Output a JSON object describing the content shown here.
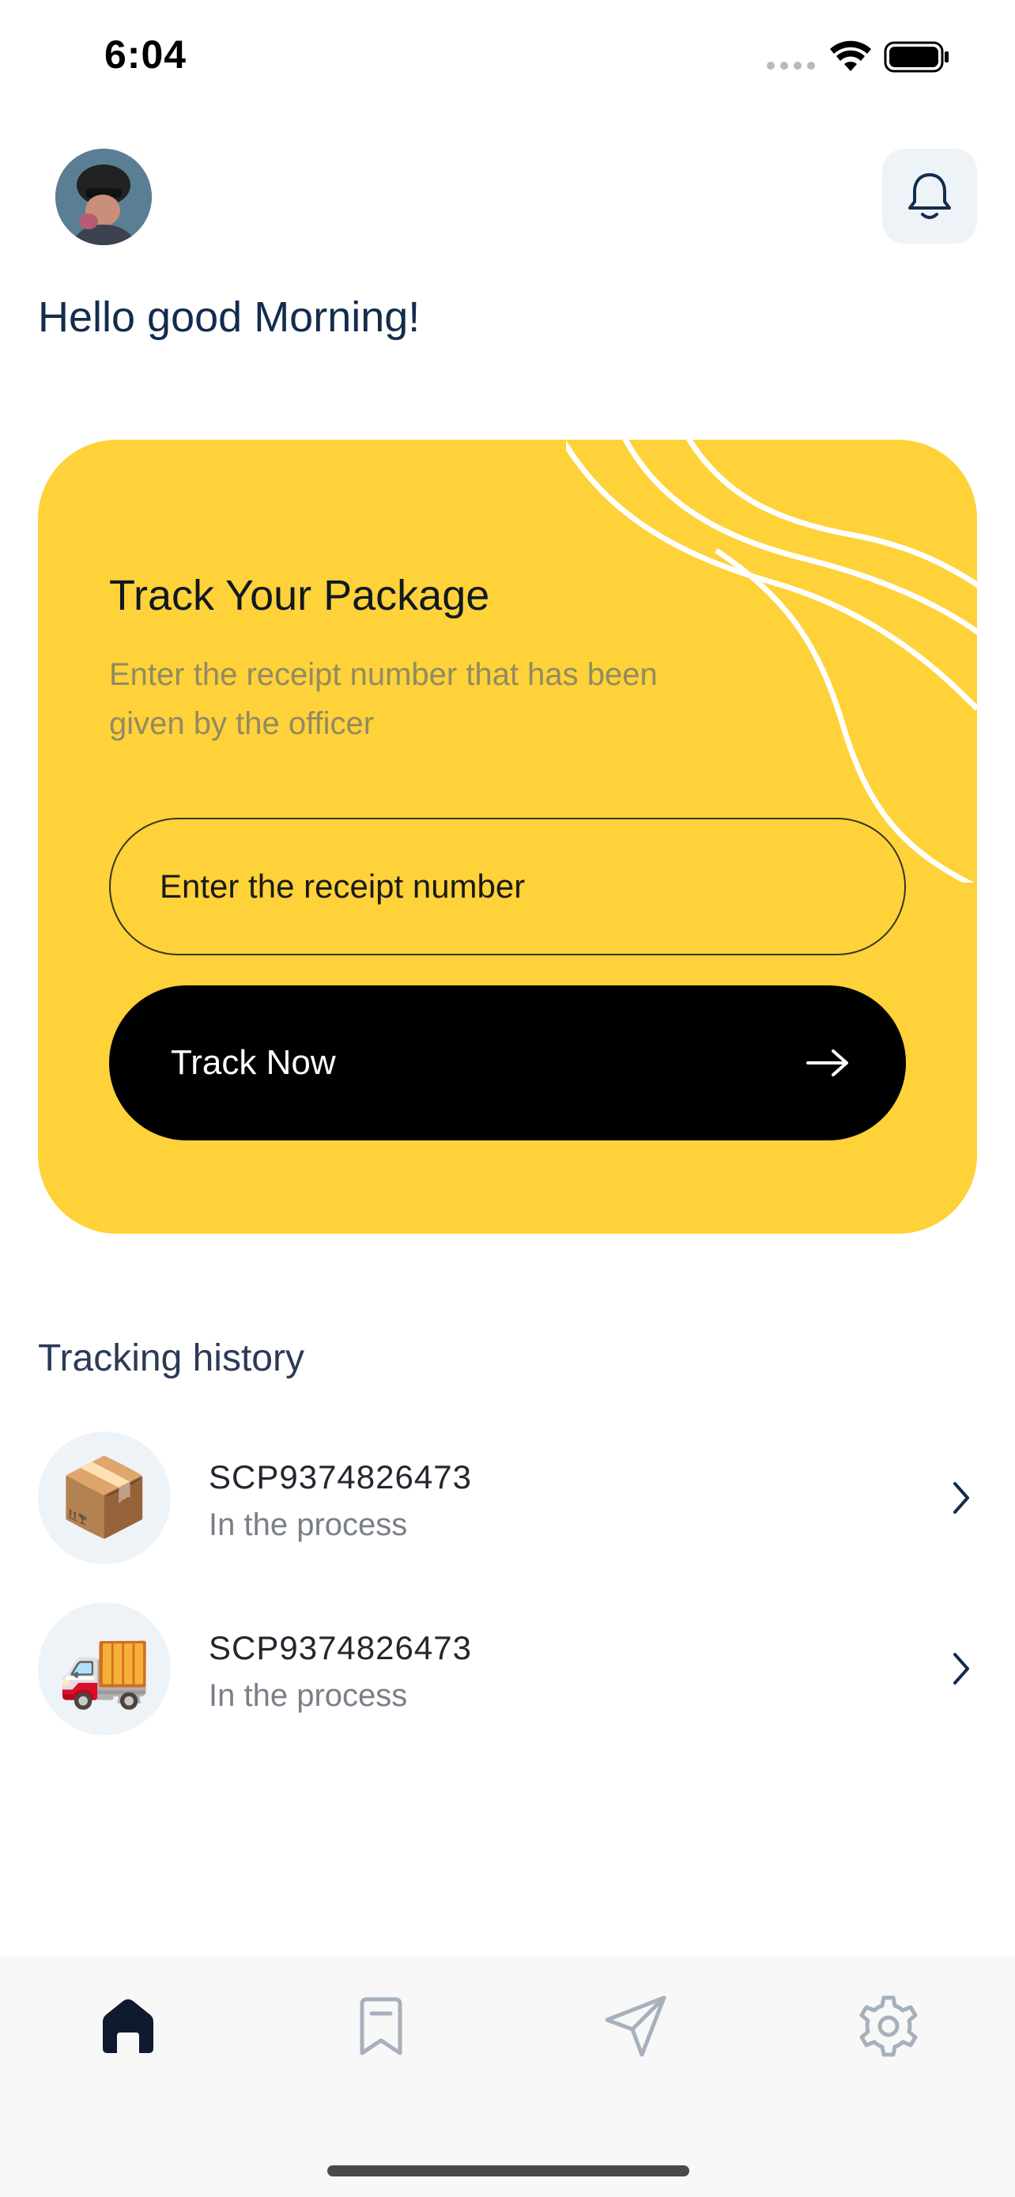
{
  "status_bar": {
    "time": "6:04"
  },
  "header": {
    "greeting": "Hello good Morning!"
  },
  "track_card": {
    "title": "Track Your Package",
    "subtitle": "Enter the receipt number that has been given by the officer",
    "input_placeholder": "Enter the receipt number",
    "button_label": "Track Now"
  },
  "history": {
    "title": "Tracking history",
    "items": [
      {
        "icon": "📦",
        "icon_name": "package-icon",
        "code": "SCP9374826473",
        "status": "In the process"
      },
      {
        "icon": "🚚",
        "icon_name": "truck-icon",
        "code": "SCP9374826473",
        "status": "In the process"
      }
    ]
  },
  "nav": {
    "items": [
      {
        "icon_name": "home-icon",
        "active": true
      },
      {
        "icon_name": "bookmark-icon",
        "active": false
      },
      {
        "icon_name": "send-icon",
        "active": false
      },
      {
        "icon_name": "settings-icon",
        "active": false
      }
    ]
  },
  "colors": {
    "card_yellow": "#fed238",
    "primary_text": "#132c4d",
    "button_black": "#000000",
    "icon_bg": "#eef3f8",
    "nav_active": "#0f1b2d",
    "nav_inactive": "#a7b0bd"
  }
}
